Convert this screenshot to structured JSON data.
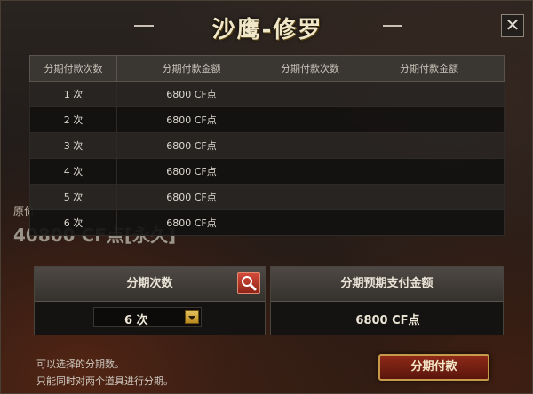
{
  "dialog": {
    "title": "沙鹰-修罗",
    "close_glyph": "✕"
  },
  "table": {
    "headers": [
      "分期付款次数",
      "分期付款金额",
      "分期付款次数",
      "分期付款金额"
    ],
    "rows": [
      {
        "count": "1 次",
        "amount": "6800 CF点"
      },
      {
        "count": "2 次",
        "amount": "6800 CF点"
      },
      {
        "count": "3 次",
        "amount": "6800 CF点"
      },
      {
        "count": "4 次",
        "amount": "6800 CF点"
      },
      {
        "count": "5 次",
        "amount": "6800 CF点"
      },
      {
        "count": "6 次",
        "amount": "6800 CF点"
      }
    ]
  },
  "background_price": {
    "label": "原价",
    "value": "40800 CF点[永久]"
  },
  "installment_panel": {
    "header": "分期次数",
    "selected_count": "6 次"
  },
  "payment_panel": {
    "header": "分期预期支付金额",
    "amount": "6800 CF点"
  },
  "notes": {
    "line1": "可以选择的分期数。",
    "line2": "只能同时对两个道具进行分期。"
  },
  "pay_button": {
    "label": "分期付款"
  },
  "colors": {
    "title": "#f0e6c8",
    "pay_button": "#8e2a18",
    "search_button": "#d34a3a",
    "dropdown_button": "#e7c460"
  },
  "icons": {
    "close": "close-icon",
    "search": "magnifier-icon",
    "dropdown": "triangle-down-icon"
  }
}
